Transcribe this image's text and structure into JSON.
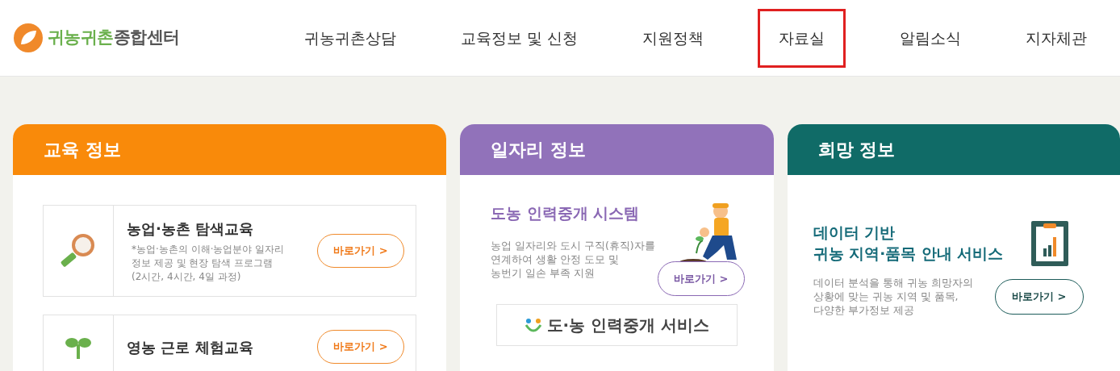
{
  "logo": {
    "highlight": "귀농귀촌",
    "rest": "종합센터"
  },
  "nav": [
    {
      "label": "귀농귀촌상담",
      "selected": false
    },
    {
      "label": "교육정보 및 신청",
      "selected": false
    },
    {
      "label": "지원정책",
      "selected": false
    },
    {
      "label": "자료실",
      "selected": true
    },
    {
      "label": "알림소식",
      "selected": false
    },
    {
      "label": "지자체관",
      "selected": false
    }
  ],
  "education": {
    "title": "교육 정보",
    "items": [
      {
        "kind": "magnifier",
        "title": "농업·농촌 탐색교육",
        "description": [
          "*농업·농촌의 이해·농업분야 일자리",
          "정보 제공 및 현장 탐색 프로그램",
          "(2시간, 4시간, 4일 과정)"
        ],
        "button": "바로가기 >"
      },
      {
        "kind": "sprout",
        "title": "영농 근로 체험교육",
        "button": "바로가기 >"
      }
    ]
  },
  "jobs": {
    "title": "일자리 정보",
    "heading": "도농 인력중개 시스템",
    "description": [
      "농업 일자리와 도시 구직(휴직)자를",
      "연계하여 생활 안정 도모 및",
      "농번기 일손 부족 지원"
    ],
    "button": "바로가기 >",
    "banner": "도·농 인력중개 서비스"
  },
  "hope": {
    "title": "희망 정보",
    "heading": [
      "데이터 기반",
      "귀농 지역·품목 안내 서비스"
    ],
    "description": [
      "데이터 분석을 통해 귀농 희망자의",
      "상황에 맞는 귀농 지역 및 품목,",
      "다양한 부가정보 제공"
    ],
    "button": "바로가기 >"
  }
}
